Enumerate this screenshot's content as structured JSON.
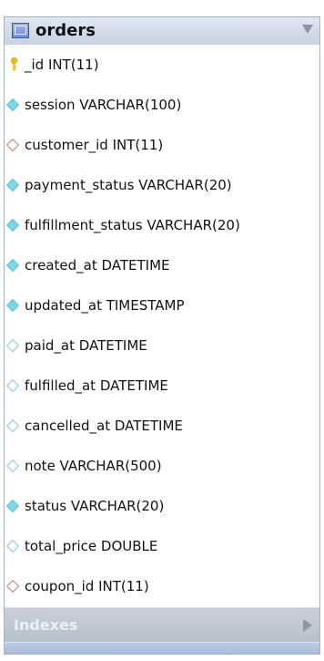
{
  "table": {
    "name": "orders",
    "columns": [
      {
        "label": "_id INT(11)",
        "icon": "primary-key-icon"
      },
      {
        "label": "session VARCHAR(100)",
        "icon": "filled-diamond-icon"
      },
      {
        "label": "customer_id INT(11)",
        "icon": "foreign-key-diamond-icon"
      },
      {
        "label": "payment_status VARCHAR(20)",
        "icon": "filled-diamond-icon"
      },
      {
        "label": "fulfillment_status VARCHAR(20)",
        "icon": "filled-diamond-icon"
      },
      {
        "label": "created_at DATETIME",
        "icon": "filled-diamond-icon"
      },
      {
        "label": "updated_at TIMESTAMP",
        "icon": "filled-diamond-icon"
      },
      {
        "label": "paid_at DATETIME",
        "icon": "open-diamond-icon"
      },
      {
        "label": "fulfilled_at DATETIME",
        "icon": "open-diamond-icon"
      },
      {
        "label": "cancelled_at DATETIME",
        "icon": "open-diamond-icon"
      },
      {
        "label": "note VARCHAR(500)",
        "icon": "open-diamond-icon"
      },
      {
        "label": "status VARCHAR(20)",
        "icon": "filled-diamond-icon"
      },
      {
        "label": "total_price DOUBLE",
        "icon": "open-diamond-icon"
      },
      {
        "label": "coupon_id INT(11)",
        "icon": "foreign-key-diamond-icon"
      }
    ],
    "indexes_label": "Indexes"
  },
  "colors": {
    "header": "#c7d3e2",
    "border": "#a9b3be",
    "filled_diamond": "#7dd5e7",
    "foreign_key": "#d17a7a",
    "key": "#f2c400",
    "indexes_bar": "#b7c0ca"
  }
}
